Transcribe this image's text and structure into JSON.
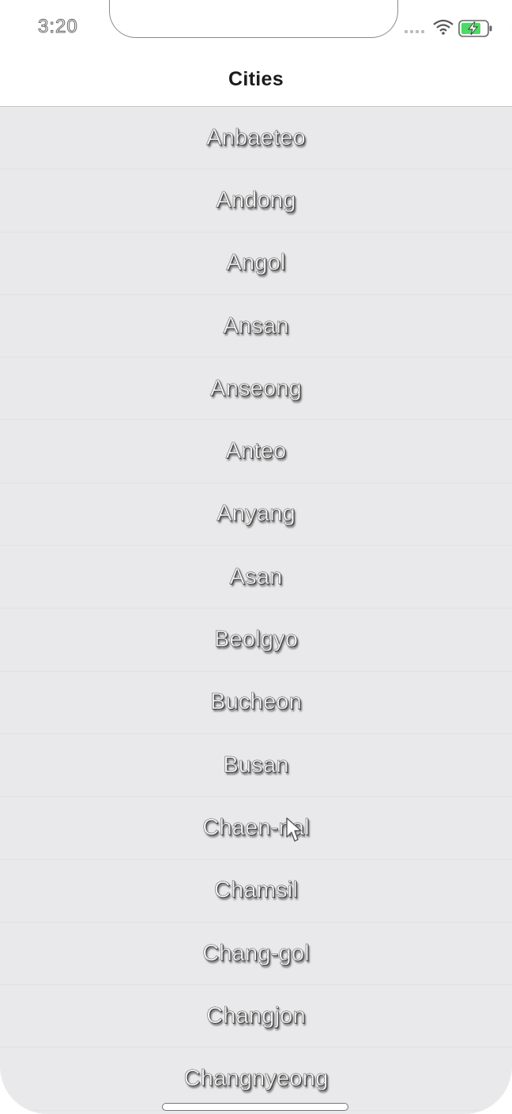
{
  "status_bar": {
    "time": "3:20",
    "icons": [
      "signal-dots-icon",
      "wifi-icon",
      "battery-charging-icon"
    ],
    "battery_color": "#4cd964"
  },
  "nav": {
    "title": "Cities"
  },
  "cities": [
    "Anbaeteo",
    "Andong",
    "Angol",
    "Ansan",
    "Anseong",
    "Anteo",
    "Anyang",
    "Asan",
    "Beolgyo",
    "Bucheon",
    "Busan",
    "Chaen-nal",
    "Chamsil",
    "Chang-gol",
    "Changjon",
    "Changnyeong"
  ],
  "colors": {
    "list_background": "#e9e9eb",
    "header_background": "#ffffff"
  }
}
